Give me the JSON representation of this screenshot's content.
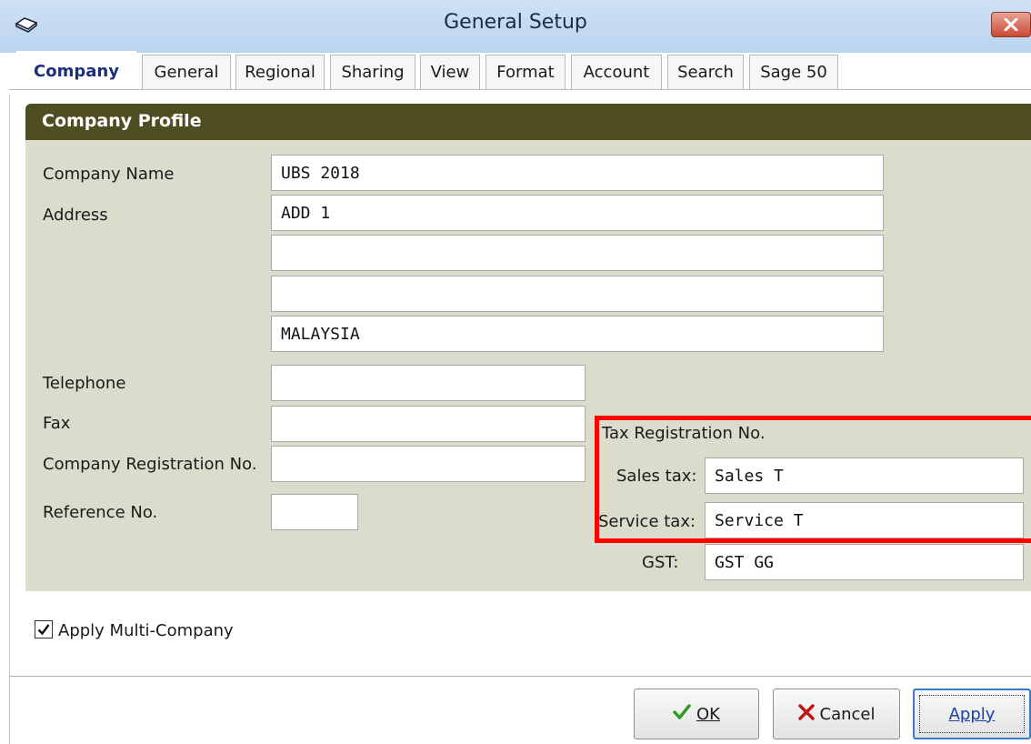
{
  "window": {
    "title": "General Setup"
  },
  "tabs": [
    {
      "label": "Company",
      "active": true
    },
    {
      "label": "General"
    },
    {
      "label": "Regional"
    },
    {
      "label": "Sharing"
    },
    {
      "label": "View"
    },
    {
      "label": "Format"
    },
    {
      "label": "Account"
    },
    {
      "label": "Search"
    },
    {
      "label": "Sage 50"
    }
  ],
  "profile": {
    "header": "Company Profile",
    "company_name_label": "Company Name",
    "company_name": "UBS 2018",
    "address_label": "Address",
    "address": [
      "ADD 1",
      "",
      "",
      "MALAYSIA"
    ],
    "telephone_label": "Telephone",
    "telephone": "",
    "fax_label": "Fax",
    "fax": "",
    "company_reg_label": "Company Registration No.",
    "company_reg": "",
    "reference_label": "Reference No.",
    "reference": ""
  },
  "tax": {
    "heading": "Tax Registration No.",
    "sales_label": "Sales tax:",
    "sales_value": "Sales T",
    "service_label": "Service tax:",
    "service_value": "Service T",
    "gst_label": "GST:",
    "gst_value": "GST GG"
  },
  "options": {
    "multi_company_label": "Apply Multi-Company",
    "multi_company_checked": true
  },
  "buttons": {
    "ok": "OK",
    "cancel": "Cancel",
    "apply": "Apply"
  },
  "colors": {
    "profile_header": "#4e4e22",
    "profile_body": "#dcdccd",
    "highlight": "#ff0000",
    "ok_icon": "#2e9a1f",
    "cancel_icon": "#c01010"
  }
}
